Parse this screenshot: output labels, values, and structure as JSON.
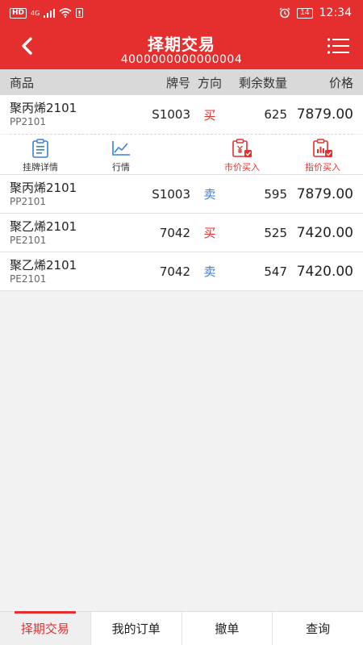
{
  "status_bar": {
    "hd": "HD",
    "net": "4G",
    "battery": "14",
    "time": "12:34"
  },
  "header": {
    "title": "择期交易",
    "account": "4000000000000004"
  },
  "table": {
    "headers": {
      "name": "商品",
      "code": "牌号",
      "direction": "方向",
      "qty": "剩余数量",
      "price": "价格"
    },
    "rows": [
      {
        "name": "聚丙烯2101",
        "contract": "PP2101",
        "code": "S1003",
        "direction": "买",
        "qty": "625",
        "price": "7879.00"
      },
      {
        "name": "聚丙烯2101",
        "contract": "PP2101",
        "code": "S1003",
        "direction": "卖",
        "qty": "595",
        "price": "7879.00"
      },
      {
        "name": "聚乙烯2101",
        "contract": "PE2101",
        "code": "7042",
        "direction": "买",
        "qty": "525",
        "price": "7420.00"
      },
      {
        "name": "聚乙烯2101",
        "contract": "PE2101",
        "code": "7042",
        "direction": "卖",
        "qty": "547",
        "price": "7420.00"
      }
    ]
  },
  "actions": {
    "detail": "挂牌详情",
    "quote": "行情",
    "market_buy": "市价买入",
    "limit_buy": "指价买入"
  },
  "tabs": {
    "t1": "择期交易",
    "t2": "我的订单",
    "t3": "撤单",
    "t4": "查询"
  },
  "colors": {
    "brand": "#e52e2e",
    "buy": "#e52e2e",
    "sell": "#3a7ed8",
    "action_icon": "#3a7ed8"
  }
}
